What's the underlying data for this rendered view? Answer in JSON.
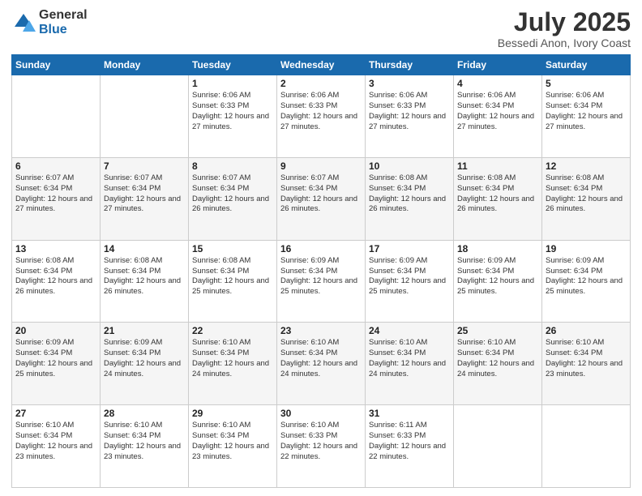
{
  "header": {
    "logo_general": "General",
    "logo_blue": "Blue",
    "month_title": "July 2025",
    "location": "Bessedi Anon, Ivory Coast"
  },
  "days_of_week": [
    "Sunday",
    "Monday",
    "Tuesday",
    "Wednesday",
    "Thursday",
    "Friday",
    "Saturday"
  ],
  "weeks": [
    [
      {
        "day": "",
        "sunrise": "",
        "sunset": "",
        "daylight": ""
      },
      {
        "day": "",
        "sunrise": "",
        "sunset": "",
        "daylight": ""
      },
      {
        "day": "1",
        "sunrise": "Sunrise: 6:06 AM",
        "sunset": "Sunset: 6:33 PM",
        "daylight": "Daylight: 12 hours and 27 minutes."
      },
      {
        "day": "2",
        "sunrise": "Sunrise: 6:06 AM",
        "sunset": "Sunset: 6:33 PM",
        "daylight": "Daylight: 12 hours and 27 minutes."
      },
      {
        "day": "3",
        "sunrise": "Sunrise: 6:06 AM",
        "sunset": "Sunset: 6:33 PM",
        "daylight": "Daylight: 12 hours and 27 minutes."
      },
      {
        "day": "4",
        "sunrise": "Sunrise: 6:06 AM",
        "sunset": "Sunset: 6:34 PM",
        "daylight": "Daylight: 12 hours and 27 minutes."
      },
      {
        "day": "5",
        "sunrise": "Sunrise: 6:06 AM",
        "sunset": "Sunset: 6:34 PM",
        "daylight": "Daylight: 12 hours and 27 minutes."
      }
    ],
    [
      {
        "day": "6",
        "sunrise": "Sunrise: 6:07 AM",
        "sunset": "Sunset: 6:34 PM",
        "daylight": "Daylight: 12 hours and 27 minutes."
      },
      {
        "day": "7",
        "sunrise": "Sunrise: 6:07 AM",
        "sunset": "Sunset: 6:34 PM",
        "daylight": "Daylight: 12 hours and 27 minutes."
      },
      {
        "day": "8",
        "sunrise": "Sunrise: 6:07 AM",
        "sunset": "Sunset: 6:34 PM",
        "daylight": "Daylight: 12 hours and 26 minutes."
      },
      {
        "day": "9",
        "sunrise": "Sunrise: 6:07 AM",
        "sunset": "Sunset: 6:34 PM",
        "daylight": "Daylight: 12 hours and 26 minutes."
      },
      {
        "day": "10",
        "sunrise": "Sunrise: 6:08 AM",
        "sunset": "Sunset: 6:34 PM",
        "daylight": "Daylight: 12 hours and 26 minutes."
      },
      {
        "day": "11",
        "sunrise": "Sunrise: 6:08 AM",
        "sunset": "Sunset: 6:34 PM",
        "daylight": "Daylight: 12 hours and 26 minutes."
      },
      {
        "day": "12",
        "sunrise": "Sunrise: 6:08 AM",
        "sunset": "Sunset: 6:34 PM",
        "daylight": "Daylight: 12 hours and 26 minutes."
      }
    ],
    [
      {
        "day": "13",
        "sunrise": "Sunrise: 6:08 AM",
        "sunset": "Sunset: 6:34 PM",
        "daylight": "Daylight: 12 hours and 26 minutes."
      },
      {
        "day": "14",
        "sunrise": "Sunrise: 6:08 AM",
        "sunset": "Sunset: 6:34 PM",
        "daylight": "Daylight: 12 hours and 26 minutes."
      },
      {
        "day": "15",
        "sunrise": "Sunrise: 6:08 AM",
        "sunset": "Sunset: 6:34 PM",
        "daylight": "Daylight: 12 hours and 25 minutes."
      },
      {
        "day": "16",
        "sunrise": "Sunrise: 6:09 AM",
        "sunset": "Sunset: 6:34 PM",
        "daylight": "Daylight: 12 hours and 25 minutes."
      },
      {
        "day": "17",
        "sunrise": "Sunrise: 6:09 AM",
        "sunset": "Sunset: 6:34 PM",
        "daylight": "Daylight: 12 hours and 25 minutes."
      },
      {
        "day": "18",
        "sunrise": "Sunrise: 6:09 AM",
        "sunset": "Sunset: 6:34 PM",
        "daylight": "Daylight: 12 hours and 25 minutes."
      },
      {
        "day": "19",
        "sunrise": "Sunrise: 6:09 AM",
        "sunset": "Sunset: 6:34 PM",
        "daylight": "Daylight: 12 hours and 25 minutes."
      }
    ],
    [
      {
        "day": "20",
        "sunrise": "Sunrise: 6:09 AM",
        "sunset": "Sunset: 6:34 PM",
        "daylight": "Daylight: 12 hours and 25 minutes."
      },
      {
        "day": "21",
        "sunrise": "Sunrise: 6:09 AM",
        "sunset": "Sunset: 6:34 PM",
        "daylight": "Daylight: 12 hours and 24 minutes."
      },
      {
        "day": "22",
        "sunrise": "Sunrise: 6:10 AM",
        "sunset": "Sunset: 6:34 PM",
        "daylight": "Daylight: 12 hours and 24 minutes."
      },
      {
        "day": "23",
        "sunrise": "Sunrise: 6:10 AM",
        "sunset": "Sunset: 6:34 PM",
        "daylight": "Daylight: 12 hours and 24 minutes."
      },
      {
        "day": "24",
        "sunrise": "Sunrise: 6:10 AM",
        "sunset": "Sunset: 6:34 PM",
        "daylight": "Daylight: 12 hours and 24 minutes."
      },
      {
        "day": "25",
        "sunrise": "Sunrise: 6:10 AM",
        "sunset": "Sunset: 6:34 PM",
        "daylight": "Daylight: 12 hours and 24 minutes."
      },
      {
        "day": "26",
        "sunrise": "Sunrise: 6:10 AM",
        "sunset": "Sunset: 6:34 PM",
        "daylight": "Daylight: 12 hours and 23 minutes."
      }
    ],
    [
      {
        "day": "27",
        "sunrise": "Sunrise: 6:10 AM",
        "sunset": "Sunset: 6:34 PM",
        "daylight": "Daylight: 12 hours and 23 minutes."
      },
      {
        "day": "28",
        "sunrise": "Sunrise: 6:10 AM",
        "sunset": "Sunset: 6:34 PM",
        "daylight": "Daylight: 12 hours and 23 minutes."
      },
      {
        "day": "29",
        "sunrise": "Sunrise: 6:10 AM",
        "sunset": "Sunset: 6:34 PM",
        "daylight": "Daylight: 12 hours and 23 minutes."
      },
      {
        "day": "30",
        "sunrise": "Sunrise: 6:10 AM",
        "sunset": "Sunset: 6:33 PM",
        "daylight": "Daylight: 12 hours and 22 minutes."
      },
      {
        "day": "31",
        "sunrise": "Sunrise: 6:11 AM",
        "sunset": "Sunset: 6:33 PM",
        "daylight": "Daylight: 12 hours and 22 minutes."
      },
      {
        "day": "",
        "sunrise": "",
        "sunset": "",
        "daylight": ""
      },
      {
        "day": "",
        "sunrise": "",
        "sunset": "",
        "daylight": ""
      }
    ]
  ]
}
